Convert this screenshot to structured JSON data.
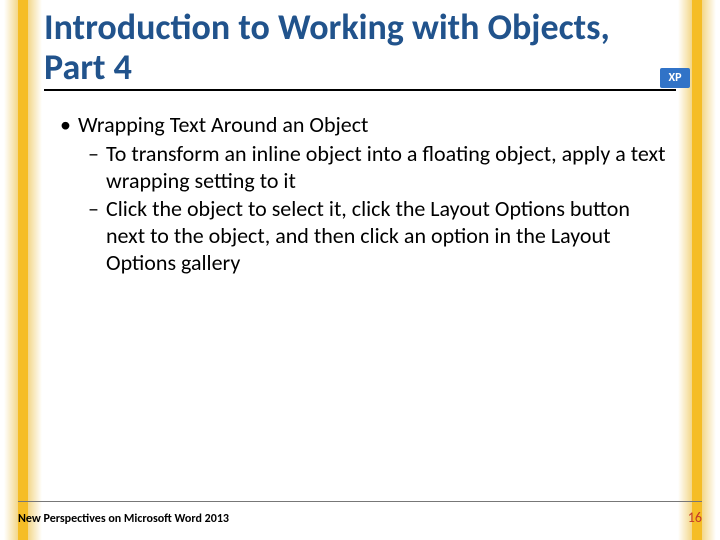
{
  "title": "Introduction to Working with Objects, Part 4",
  "bullets": {
    "lvl1_0": "Wrapping Text Around an Object",
    "lvl2_0": "To transform an inline object into a floating object, apply a text wrapping setting to it",
    "lvl2_1": "Click the object to select it, click the Layout Options button next to the object, and then click an option in the Layout Options gallery"
  },
  "footer": "New Perspectives on Microsoft Word 2013",
  "page_number": "16",
  "badge": "XP"
}
